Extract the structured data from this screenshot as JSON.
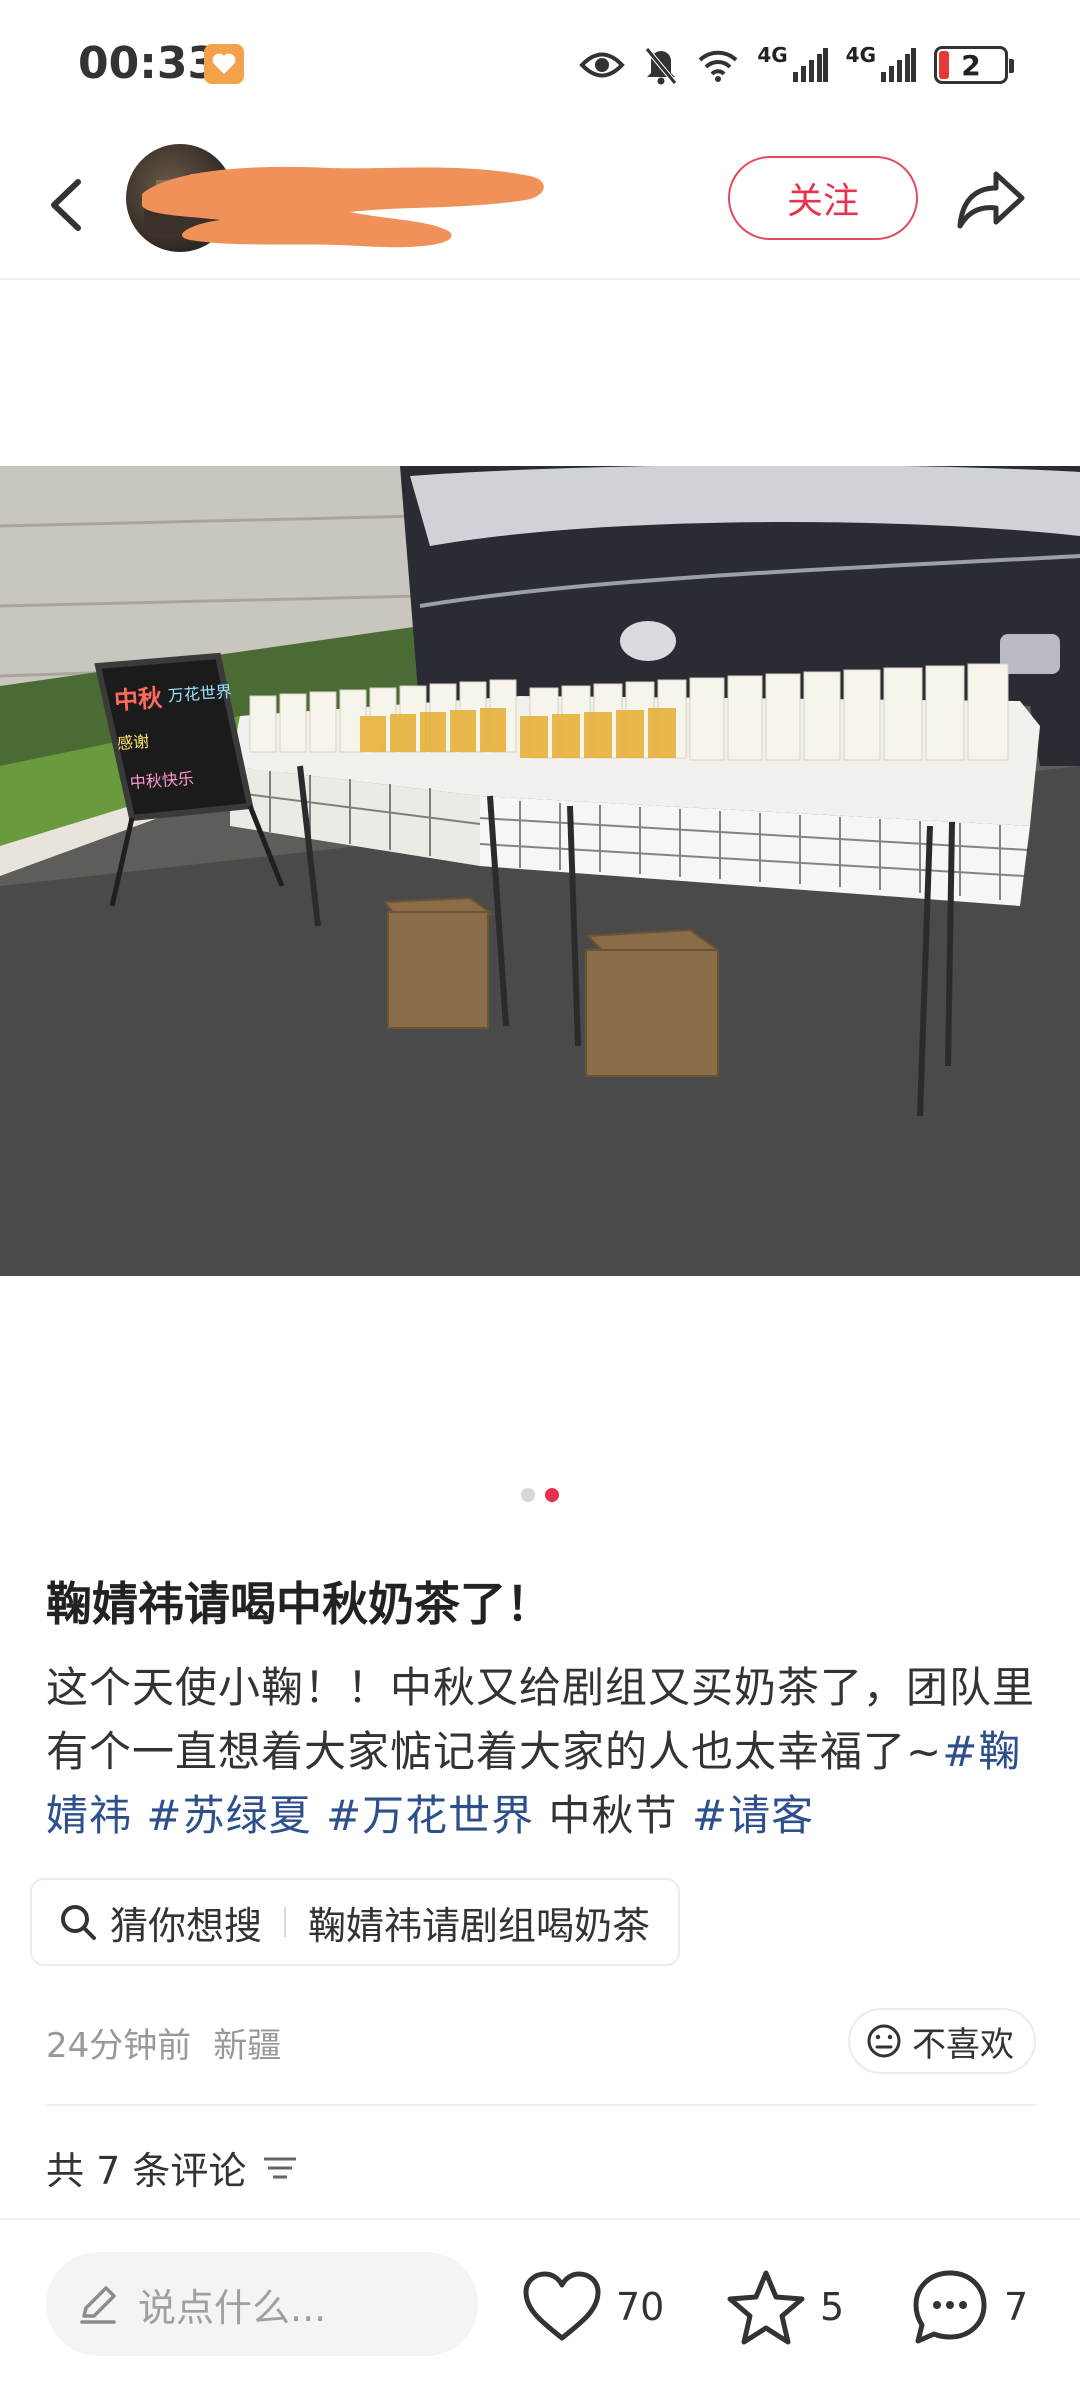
{
  "status_bar": {
    "time": "00:33",
    "network_1": "4G",
    "network_2": "4G",
    "battery": "2"
  },
  "header": {
    "follow_label": "关注"
  },
  "carousel": {
    "total_pages": 2,
    "active_page": 2
  },
  "post": {
    "title": "鞠婧祎请喝中秋奶茶了！",
    "body_text": "这个天使小鞠！！中秋又给剧组又买奶茶了，团队里有个一直想着大家惦记着大家的人也太幸福了~",
    "tags": [
      "#鞠婧祎",
      "#苏绿夏",
      "#万花世界",
      "中秋节",
      "#请客"
    ]
  },
  "search_suggest": {
    "label": "猜你想搜",
    "query": "鞠婧祎请剧组喝奶茶"
  },
  "meta": {
    "time_ago": "24分钟前",
    "location": "新疆",
    "dislike_label": "不喜欢"
  },
  "comments": {
    "count_label": "共 7 条评论"
  },
  "bottom_bar": {
    "input_placeholder": "说点什么...",
    "likes": "70",
    "favorites": "5",
    "comment_count": "7"
  },
  "colors": {
    "accent": "#e8334f",
    "tag": "#2d4f8c"
  }
}
